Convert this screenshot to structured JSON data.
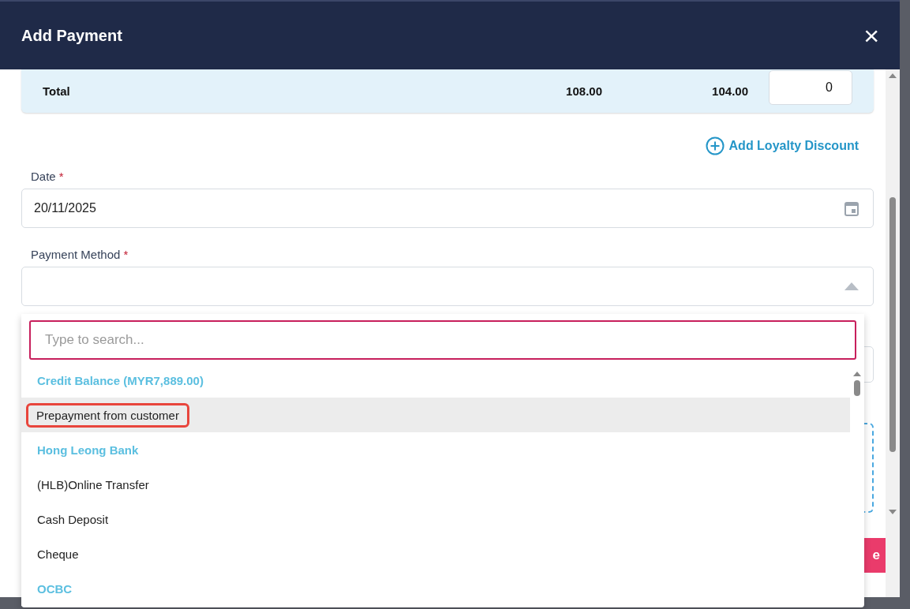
{
  "dialog": {
    "title": "Add Payment",
    "close": "×"
  },
  "summary": {
    "label": "Total",
    "amount_1": "108.00",
    "amount_2": "104.00",
    "input_value": "0"
  },
  "loyalty_link": "Add Loyalty Discount",
  "date_field": {
    "label": "Date",
    "required_mark": "*",
    "value": "20/11/2025"
  },
  "payment_method": {
    "label": "Payment Method",
    "required_mark": "*",
    "expanded": true
  },
  "hidden_button": {
    "label": "e"
  },
  "payment_dropdown": {
    "search_placeholder": "Type to search...",
    "options": [
      {
        "kind": "group",
        "label": "Credit Balance (MYR7,889.00)",
        "selected": false
      },
      {
        "kind": "option",
        "label": "Prepayment from customer",
        "selected": true
      },
      {
        "kind": "group",
        "label": "Hong Leong Bank",
        "selected": false
      },
      {
        "kind": "option",
        "label": "(HLB)Online Transfer",
        "selected": false
      },
      {
        "kind": "option",
        "label": "Cash Deposit",
        "selected": false
      },
      {
        "kind": "option",
        "label": "Cheque",
        "selected": false
      },
      {
        "kind": "group",
        "label": "OCBC",
        "selected": false
      }
    ]
  }
}
